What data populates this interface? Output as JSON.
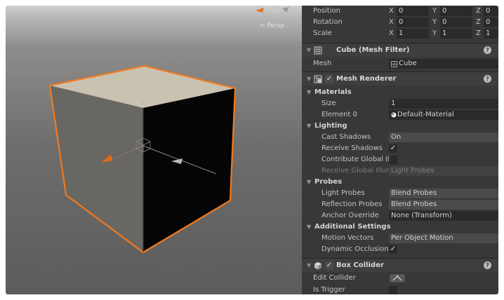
{
  "scene": {
    "persp_label": "< Persp"
  },
  "transform": {
    "position": {
      "label": "Position",
      "x": "0",
      "y": "0",
      "z": "0"
    },
    "rotation": {
      "label": "Rotation",
      "x": "0",
      "y": "0",
      "z": "0"
    },
    "scale": {
      "label": "Scale",
      "x": "1",
      "y": "1",
      "z": "1"
    },
    "axis_x": "X",
    "axis_y": "Y",
    "axis_z": "Z"
  },
  "mesh_filter": {
    "title": "Cube (Mesh Filter)",
    "mesh_label": "Mesh",
    "mesh_value": "Cube",
    "icon": "grid-mesh-icon"
  },
  "mesh_renderer": {
    "title": "Mesh Renderer",
    "enabled_mark": "✓",
    "icon": "mesh-renderer-icon",
    "materials": {
      "section": "Materials",
      "size_label": "Size",
      "size_value": "1",
      "element0_label": "Element 0",
      "element0_value": "Default-Material"
    },
    "lighting": {
      "section": "Lighting",
      "cast_shadows_label": "Cast Shadows",
      "cast_shadows_value": "On",
      "receive_shadows_label": "Receive Shadows",
      "receive_shadows_checked": "✓",
      "contribute_gi_label": "Contribute Global Illu",
      "receive_gi_label": "Receive Global Illumi",
      "receive_gi_value": "Light Probes"
    },
    "probes": {
      "section": "Probes",
      "light_probes_label": "Light Probes",
      "light_probes_value": "Blend Probes",
      "reflection_probes_label": "Reflection Probes",
      "reflection_probes_value": "Blend Probes",
      "anchor_override_label": "Anchor Override",
      "anchor_override_value": "None (Transform)"
    },
    "additional": {
      "section": "Additional Settings",
      "motion_vectors_label": "Motion Vectors",
      "motion_vectors_value": "Per Object Motion",
      "dynamic_occlusion_label": "Dynamic Occlusion",
      "dynamic_occlusion_checked": "✓"
    }
  },
  "box_collider": {
    "title": "Box Collider",
    "enabled_mark": "✓",
    "icon": "box-collider-icon",
    "edit_collider_label": "Edit Collider",
    "is_trigger_label": "Is Trigger"
  },
  "help_glyph": "?",
  "fold_glyph": "▼",
  "colors": {
    "selection_outline": "#f07a20",
    "inspector_bg": "#383838",
    "field_bg": "#2a2a2a"
  }
}
